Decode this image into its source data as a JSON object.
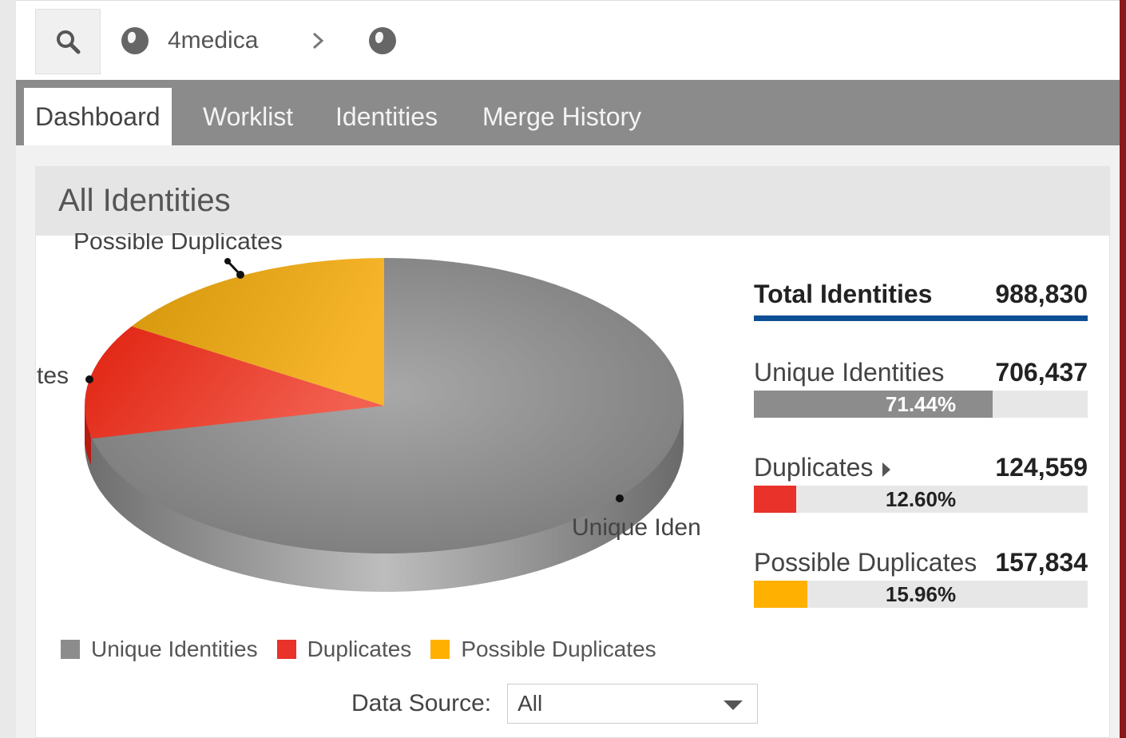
{
  "breadcrumb": {
    "org": "4medica"
  },
  "tabs": [
    "Dashboard",
    "Worklist",
    "Identities",
    "Merge History"
  ],
  "panel": {
    "title": "All Identities"
  },
  "chart_labels": {
    "possible": "Possible Duplicates",
    "dup_partial": "tes",
    "unique_partial": "Unique Iden"
  },
  "chart_data": {
    "type": "pie",
    "slices": [
      {
        "name": "Unique Identities",
        "value": 706437,
        "percent": 71.44,
        "color": "#8c8c8c"
      },
      {
        "name": "Duplicates",
        "value": 124559,
        "percent": 12.6,
        "color": "#e8322a"
      },
      {
        "name": "Possible Duplicates",
        "value": 157834,
        "percent": 15.96,
        "color": "#f0a81a"
      }
    ],
    "legend": [
      "Unique Identities",
      "Duplicates",
      "Possible Duplicates"
    ],
    "legend_placement": "bottom"
  },
  "stats": {
    "total_label": "Total Identities",
    "total_value": "988,830",
    "items": [
      {
        "label": "Unique Identities",
        "value": "706,437",
        "percent": "71.44%",
        "fraction": 0.7144,
        "color": "#8c8c8c"
      },
      {
        "label": "Duplicates",
        "value": "124,559",
        "percent": "12.60%",
        "fraction": 0.126,
        "color": "#e8322a"
      },
      {
        "label": "Possible Duplicates",
        "value": "157,834",
        "percent": "15.96%",
        "fraction": 0.1596,
        "color": "#ffb000"
      }
    ]
  },
  "datasource": {
    "label": "Data Source:",
    "value": "All"
  },
  "colors": {
    "accent": "#0d4f94",
    "tabbar": "#8b8b8b",
    "frame": "#8a1a1a"
  }
}
